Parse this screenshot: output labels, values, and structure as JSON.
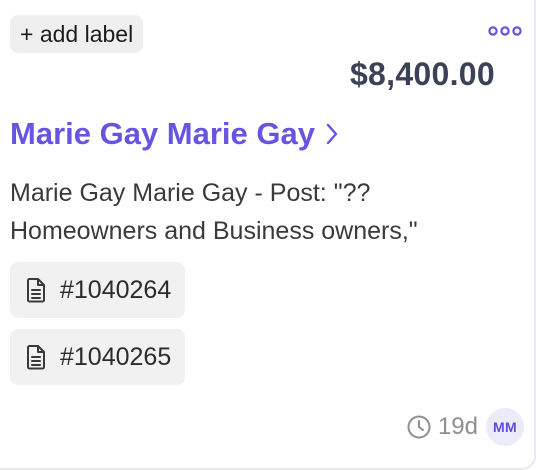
{
  "card": {
    "add_label": "+ add label",
    "more_icon": "more-horizontal-icon",
    "amount": "$8,400.00",
    "title": "Marie Gay Marie Gay",
    "title_chevron_icon": "chevron-right-icon",
    "description": "Marie Gay Marie Gay - Post: \"?? Homeowners and Business owners,\"",
    "refs": [
      {
        "icon": "document-icon",
        "label": "#1040264"
      },
      {
        "icon": "document-icon",
        "label": "#1040265"
      }
    ],
    "footer": {
      "clock_icon": "clock-icon",
      "age": "19d",
      "avatar_initials": "MM"
    }
  },
  "colors": {
    "accent": "#6655e0",
    "amount": "#3c4256",
    "muted": "#8e8e93",
    "chip_bg": "#f1f1f1",
    "avatar_bg": "#ecebfa",
    "avatar_text": "#5a4fd6"
  }
}
